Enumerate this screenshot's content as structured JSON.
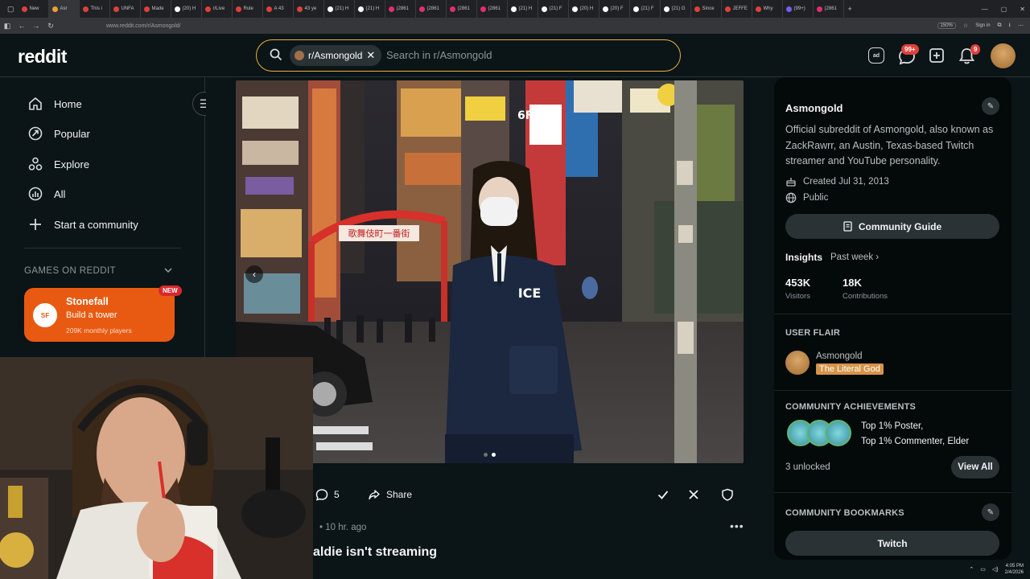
{
  "browser": {
    "tabs": [
      "New",
      "Asr",
      "This i",
      "UNFA",
      "Made",
      "(20) H",
      "r/Live",
      "Rule",
      "A 43",
      "43 ye",
      "(21) H",
      "(21) H",
      "(2861",
      "(2861",
      "(2861",
      "(2861",
      "(21) H",
      "(21) F",
      "(20) H",
      "(20) F",
      "(21) F",
      "(21) G",
      "Since",
      "JEFFE",
      "Why",
      "(99+)",
      "(2861"
    ],
    "active_tab_index": 1,
    "url": "www.reddit.com/r/Asmongold/",
    "zoom": "150%",
    "sign_in": "Sign in",
    "clock_time": "4:05 PM",
    "clock_date": "2/4/2026"
  },
  "header": {
    "logo": "reddit",
    "search_chip": "r/Asmongold",
    "search_placeholder": "Search in r/Asmongold",
    "chat_badge": "99+",
    "notif_badge": "9"
  },
  "sidebar": {
    "items": [
      {
        "label": "Home",
        "icon": "home-icon"
      },
      {
        "label": "Popular",
        "icon": "popular-icon"
      },
      {
        "label": "Explore",
        "icon": "explore-icon"
      },
      {
        "label": "All",
        "icon": "all-icon"
      },
      {
        "label": "Start a community",
        "icon": "plus-icon"
      }
    ],
    "games_header": "GAMES ON REDDIT",
    "game": {
      "badge": "NEW",
      "title": "Stonefall",
      "subtitle": "Build a tower",
      "players": "209K monthly players",
      "logo_text": "SF"
    }
  },
  "post": {
    "comments": "5",
    "share": "Share",
    "meta": "• 10 hr. ago",
    "title": "aldie isn't streaming",
    "image_text": {
      "badge": "ICE",
      "gate_sign": "歌舞伎町一番街",
      "sign_6f": "6F"
    }
  },
  "community": {
    "name": "Asmongold",
    "description": "Official subreddit of Asmongold, also known as ZackRawrr, an Austin, Texas-based Twitch streamer and YouTube personality.",
    "created": "Created Jul 31, 2013",
    "visibility": "Public",
    "guide_button": "Community Guide",
    "insights_label": "Insights",
    "insights_period": "Past week",
    "visitors_value": "453K",
    "visitors_label": "Visitors",
    "contributions_value": "18K",
    "contributions_label": "Contributions",
    "user_flair_header": "USER FLAIR",
    "flair_user": "Asmongold",
    "flair_tag": "The Literal God",
    "achievements_header": "COMMUNITY ACHIEVEMENTS",
    "achievements_line1": "Top 1% Poster,",
    "achievements_line2": "Top 1% Commenter, Elder",
    "unlocked": "3 unlocked",
    "view_all": "View All",
    "bookmarks_header": "COMMUNITY BOOKMARKS",
    "bookmark_twitch": "Twitch"
  },
  "colors": {
    "accent_search": "#e8b23a",
    "game_card": "#e85a12",
    "badge_red": "#e0403a",
    "flair_tag": "#d6944a"
  }
}
